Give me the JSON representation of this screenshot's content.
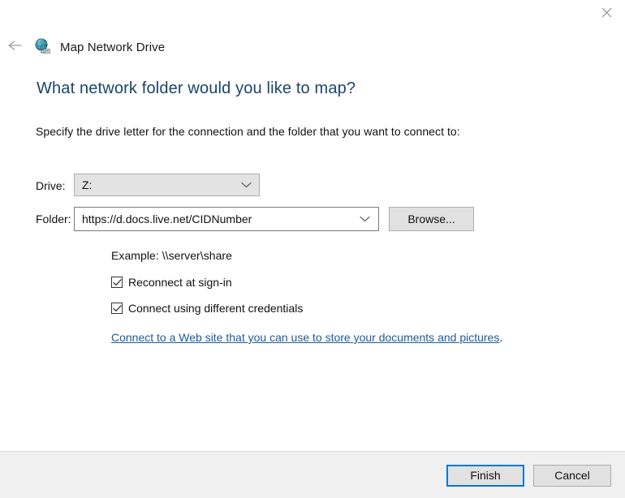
{
  "window": {
    "close_label": "Close",
    "close_icon": "close-icon"
  },
  "nav": {
    "back_icon": "back-arrow-icon",
    "app_icon": "map-network-drive-icon",
    "title": "Map Network Drive"
  },
  "main": {
    "heading": "What network folder would you like to map?",
    "subtitle": "Specify the drive letter for the connection and the folder that you want to connect to:"
  },
  "form": {
    "drive": {
      "label": "Drive:",
      "value": "Z:",
      "chevron_icon": "chevron-down-icon"
    },
    "folder": {
      "label": "Folder:",
      "value": "https://d.docs.live.net/CIDNumber",
      "placeholder": "",
      "chevron_icon": "chevron-down-icon",
      "browse_label": "Browse..."
    },
    "example_text": "Example: \\\\server\\share",
    "checkboxes": [
      {
        "label": "Reconnect at sign-in",
        "checked": true
      },
      {
        "label": "Connect using different credentials",
        "checked": true
      }
    ],
    "link": {
      "text": "Connect to a Web site that you can use to store your documents and pictures",
      "trailing": "."
    }
  },
  "footer": {
    "finish_label": "Finish",
    "cancel_label": "Cancel"
  },
  "colors": {
    "heading": "#19456b",
    "link": "#1d5b96",
    "accent": "#0078d7",
    "button_face": "#e1e1e1",
    "footer_bg": "#f0f0f0"
  }
}
